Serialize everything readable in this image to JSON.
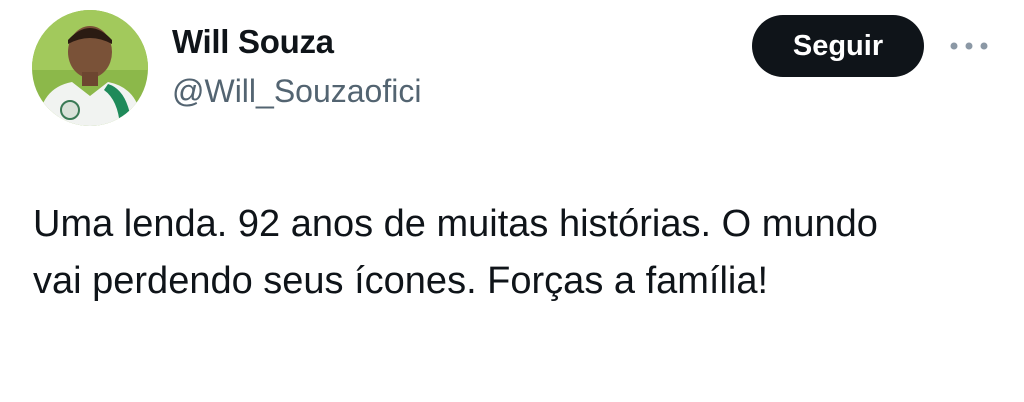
{
  "tweet": {
    "author": {
      "display_name": "Will Souza",
      "handle": "@Will_Souzaofici",
      "avatar_icon": "profile-photo"
    },
    "follow_label": "Seguir",
    "more_icon": "more-horizontal-icon",
    "text": "Uma lenda. 92 anos de muitas histórias. O mundo vai perdendo seus ícones. Forças a família!"
  },
  "colors": {
    "text_primary": "#0f1419",
    "text_secondary": "#536471",
    "button_bg": "#0f1419",
    "button_text": "#ffffff",
    "background": "#ffffff"
  }
}
